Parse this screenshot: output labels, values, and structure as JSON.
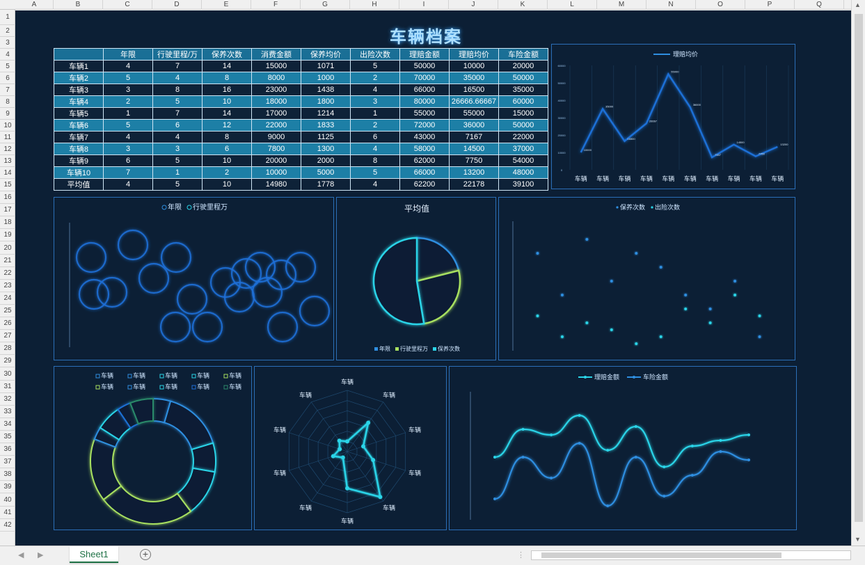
{
  "columns": [
    "A",
    "B",
    "C",
    "D",
    "E",
    "F",
    "G",
    "H",
    "I",
    "J",
    "K",
    "L",
    "M",
    "N",
    "O",
    "P",
    "Q"
  ],
  "rows": [
    "1",
    "2",
    "3",
    "4",
    "5",
    "6",
    "7",
    "8",
    "9",
    "10",
    "11",
    "12",
    "13",
    "14",
    "15",
    "16",
    "17",
    "18",
    "19",
    "20",
    "21",
    "22",
    "23",
    "24",
    "25",
    "26",
    "27",
    "28",
    "29",
    "30",
    "31",
    "32",
    "33",
    "34",
    "35",
    "36",
    "37",
    "38",
    "39",
    "40",
    "41",
    "42"
  ],
  "title": "车辆档案",
  "table": {
    "headers": [
      "",
      "年限",
      "行驶里程/万",
      "保养次数",
      "消费金额",
      "保养均价",
      "出险次数",
      "理赔金额",
      "理赔均价",
      "车险金额"
    ],
    "rows": [
      [
        "车辆1",
        "4",
        "7",
        "14",
        "15000",
        "1071",
        "5",
        "50000",
        "10000",
        "20000"
      ],
      [
        "车辆2",
        "5",
        "4",
        "8",
        "8000",
        "1000",
        "2",
        "70000",
        "35000",
        "50000"
      ],
      [
        "车辆3",
        "3",
        "8",
        "16",
        "23000",
        "1438",
        "4",
        "66000",
        "16500",
        "35000"
      ],
      [
        "车辆4",
        "2",
        "5",
        "10",
        "18000",
        "1800",
        "3",
        "80000",
        "26666.66667",
        "60000"
      ],
      [
        "车辆5",
        "1",
        "7",
        "14",
        "17000",
        "1214",
        "1",
        "55000",
        "55000",
        "15000"
      ],
      [
        "车辆6",
        "5",
        "6",
        "12",
        "22000",
        "1833",
        "2",
        "72000",
        "36000",
        "50000"
      ],
      [
        "车辆7",
        "4",
        "4",
        "8",
        "9000",
        "1125",
        "6",
        "43000",
        "7167",
        "22000"
      ],
      [
        "车辆8",
        "3",
        "3",
        "6",
        "7800",
        "1300",
        "4",
        "58000",
        "14500",
        "37000"
      ],
      [
        "车辆9",
        "6",
        "5",
        "10",
        "20000",
        "2000",
        "8",
        "62000",
        "7750",
        "54000"
      ],
      [
        "车辆10",
        "7",
        "1",
        "2",
        "10000",
        "5000",
        "5",
        "66000",
        "13200",
        "48000"
      ]
    ],
    "avg": [
      "平均值",
      "4",
      "5",
      "10",
      "14980",
      "1778",
      "4",
      "62200",
      "22178",
      "39100"
    ]
  },
  "charts": {
    "line": {
      "legend": "理赔均价",
      "xlabels": [
        "车辆",
        "车辆",
        "车辆",
        "车辆",
        "车辆",
        "车辆",
        "车辆",
        "车辆",
        "车辆",
        "车辆"
      ]
    },
    "bubble": {
      "legend": [
        "年限",
        "行驶里程万"
      ]
    },
    "pie": {
      "title": "平均值",
      "legend": [
        "年限",
        "行驶里程万",
        "保养次数"
      ]
    },
    "scatter": {
      "legend": [
        "保养次数",
        "出险次数"
      ]
    },
    "donut": {
      "legend": [
        "车辆",
        "车辆",
        "车辆",
        "车辆",
        "车辆",
        "车辆",
        "车辆",
        "车辆",
        "车辆",
        "车辆"
      ]
    },
    "radar": {
      "labels": [
        "车辆",
        "车辆",
        "车辆",
        "车辆",
        "车辆",
        "车辆",
        "车辆",
        "车辆",
        "车辆",
        "车辆"
      ]
    },
    "smooth": {
      "legend": [
        "理赔金额",
        "车险金额"
      ]
    }
  },
  "chart_data": [
    {
      "type": "line",
      "series": [
        {
          "name": "理赔均价",
          "values": [
            10000,
            35000,
            16500,
            26666.67,
            55000,
            36000,
            7167,
            14500,
            7750,
            13200
          ]
        }
      ],
      "categories": [
        "车辆1",
        "车辆2",
        "车辆3",
        "车辆4",
        "车辆5",
        "车辆6",
        "车辆7",
        "车辆8",
        "车辆9",
        "车辆10"
      ]
    },
    {
      "type": "pie",
      "title": "平均值",
      "categories": [
        "年限",
        "行驶里程万",
        "保养次数"
      ],
      "values": [
        4,
        5,
        10
      ]
    },
    {
      "type": "scatter",
      "series": [
        {
          "name": "保养次数",
          "values": [
            14,
            8,
            16,
            10,
            14,
            12,
            8,
            6,
            10,
            2
          ]
        },
        {
          "name": "出险次数",
          "values": [
            5,
            2,
            4,
            3,
            1,
            2,
            6,
            4,
            8,
            5
          ]
        }
      ]
    },
    {
      "type": "line",
      "series": [
        {
          "name": "理赔金额",
          "values": [
            50000,
            70000,
            66000,
            80000,
            55000,
            72000,
            43000,
            58000,
            62000,
            66000
          ]
        },
        {
          "name": "车险金额",
          "values": [
            20000,
            50000,
            35000,
            60000,
            15000,
            50000,
            22000,
            37000,
            54000,
            48000
          ]
        }
      ]
    }
  ],
  "sheet_tab": "Sheet1",
  "colors": {
    "bg": "#0c1f35",
    "accent": "#2f8ee0",
    "cyan": "#2ad4e8",
    "green": "#a8e060"
  }
}
